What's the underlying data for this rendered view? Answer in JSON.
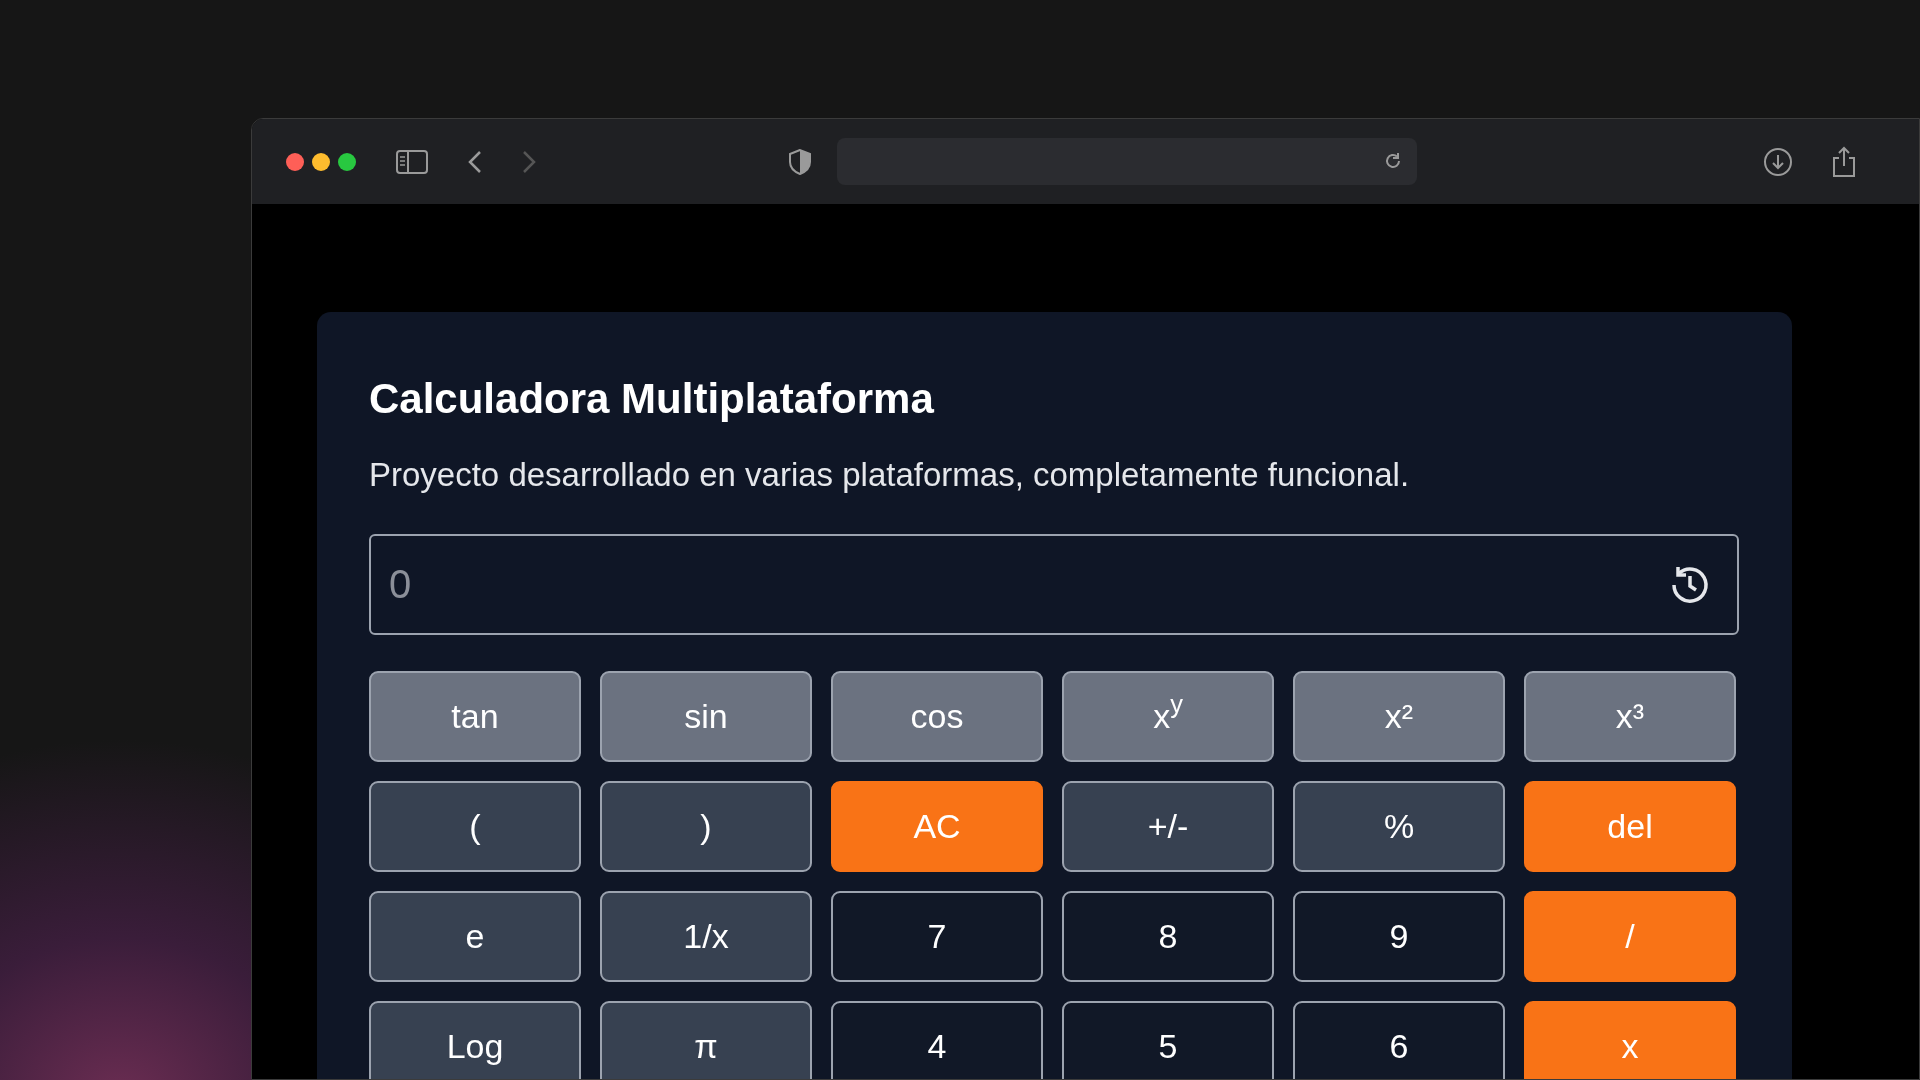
{
  "card": {
    "title": "Calculadora Multiplataforma",
    "subtitle": "Proyecto desarrollado en varias plataformas, completamente funcional."
  },
  "display": {
    "placeholder": "0"
  },
  "keys": [
    {
      "label": "tan",
      "kind": "function"
    },
    {
      "label": "sin",
      "kind": "function"
    },
    {
      "label": "cos",
      "kind": "function"
    },
    {
      "label": "x$^{y}$",
      "kind": "function"
    },
    {
      "label": "x²",
      "kind": "function"
    },
    {
      "label": "x³",
      "kind": "function"
    },
    {
      "label": "(",
      "kind": "operator"
    },
    {
      "label": ")",
      "kind": "operator"
    },
    {
      "label": "AC",
      "kind": "accent"
    },
    {
      "label": "+/-",
      "kind": "operator"
    },
    {
      "label": "%",
      "kind": "operator"
    },
    {
      "label": "del",
      "kind": "accent"
    },
    {
      "label": "e",
      "kind": "operator"
    },
    {
      "label": "1/x",
      "kind": "operator"
    },
    {
      "label": "7",
      "kind": "number"
    },
    {
      "label": "8",
      "kind": "number"
    },
    {
      "label": "9",
      "kind": "number"
    },
    {
      "label": "/",
      "kind": "accent"
    },
    {
      "label": "Log",
      "kind": "operator"
    },
    {
      "label": "π",
      "kind": "operator"
    },
    {
      "label": "4",
      "kind": "number"
    },
    {
      "label": "5",
      "kind": "number"
    },
    {
      "label": "6",
      "kind": "number"
    },
    {
      "label": "x",
      "kind": "accent"
    }
  ]
}
